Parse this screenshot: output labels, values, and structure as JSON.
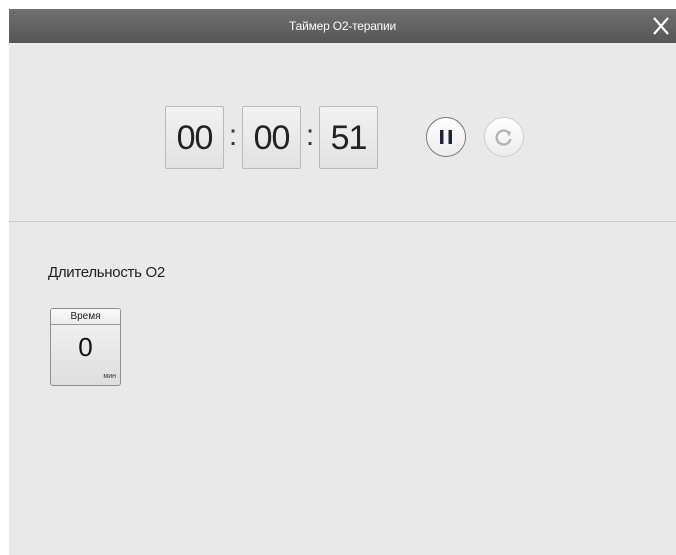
{
  "window": {
    "title": "Таймер O2-терапии",
    "close_icon": "close-icon"
  },
  "timer": {
    "hours": "00",
    "minutes": "00",
    "seconds": "51",
    "separator": ":",
    "pause_icon": "pause-icon",
    "reset_icon": "reset-icon"
  },
  "duration": {
    "label": "Длительность O2",
    "card_header": "Время",
    "value": "0",
    "unit": "мин"
  },
  "colors": {
    "titlebar": "#5e5e5e",
    "background": "#e9e9e9",
    "pause_ring": "#7a7a7a",
    "reset_disabled": "#bdbdbd"
  }
}
